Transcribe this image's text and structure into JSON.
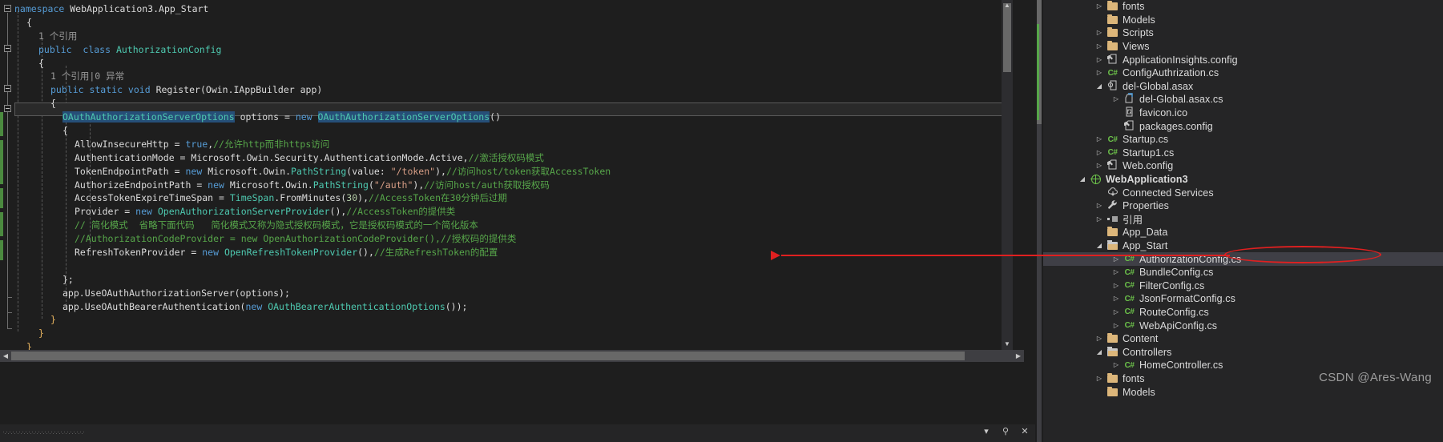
{
  "editor": {
    "selection_text": "OAuthAuthorizationServerOptions",
    "code_lines": [
      {
        "indent": 0,
        "tokens": [
          {
            "t": "namespace ",
            "c": "t-kw"
          },
          {
            "t": "WebApplication3.App_Start",
            "c": "t-txt"
          }
        ]
      },
      {
        "indent": 1,
        "tokens": [
          {
            "t": "{",
            "c": "t-punc"
          }
        ]
      },
      {
        "indent": 2,
        "tokens": [
          {
            "t": "1 个引用",
            "c": "t-hint"
          }
        ]
      },
      {
        "indent": 2,
        "tokens": [
          {
            "t": "public  ",
            "c": "t-kw"
          },
          {
            "t": "class ",
            "c": "t-kw"
          },
          {
            "t": "AuthorizationConfig",
            "c": "t-type"
          }
        ]
      },
      {
        "indent": 2,
        "tokens": [
          {
            "t": "{",
            "c": "t-punc"
          }
        ]
      },
      {
        "indent": 3,
        "tokens": [
          {
            "t": "1 个引用|0 异常",
            "c": "t-hint"
          }
        ]
      },
      {
        "indent": 3,
        "tokens": [
          {
            "t": "public static void ",
            "c": "t-kw"
          },
          {
            "t": "Register",
            "c": "t-txt"
          },
          {
            "t": "(",
            "c": "t-punc"
          },
          {
            "t": "Owin.IAppBuilder",
            "c": "t-txt"
          },
          {
            "t": " app)",
            "c": "t-punc"
          }
        ]
      },
      {
        "indent": 3,
        "tokens": [
          {
            "t": "{",
            "c": "t-punc"
          }
        ]
      },
      {
        "indent": 4,
        "tokens": [
          {
            "t": "OAuthAuthorizationServerOptions",
            "c": "sel"
          },
          {
            "t": " options = ",
            "c": "t-txt"
          },
          {
            "t": "new ",
            "c": "t-kw"
          },
          {
            "t": "OAuthAuthorizationServerOptions",
            "c": "sel"
          },
          {
            "t": "()",
            "c": "t-punc"
          }
        ]
      },
      {
        "indent": 4,
        "tokens": [
          {
            "t": "{",
            "c": "t-punc"
          }
        ]
      },
      {
        "indent": 5,
        "tokens": [
          {
            "t": "AllowInsecureHttp = ",
            "c": "t-txt"
          },
          {
            "t": "true",
            "c": "t-kw"
          },
          {
            "t": ",",
            "c": "t-punc"
          },
          {
            "t": "//允许http而非https访问",
            "c": "t-cmt"
          }
        ]
      },
      {
        "indent": 5,
        "tokens": [
          {
            "t": "AuthenticationMode = Microsoft.Owin.Security.AuthenticationMode.Active,",
            "c": "t-txt"
          },
          {
            "t": "//激活授权码模式",
            "c": "t-cmt"
          }
        ]
      },
      {
        "indent": 5,
        "tokens": [
          {
            "t": "TokenEndpointPath = ",
            "c": "t-txt"
          },
          {
            "t": "new ",
            "c": "t-kw"
          },
          {
            "t": "Microsoft.Owin.",
            "c": "t-txt"
          },
          {
            "t": "PathString",
            "c": "t-type"
          },
          {
            "t": "(value: ",
            "c": "t-punc"
          },
          {
            "t": "\"/token\"",
            "c": "t-str"
          },
          {
            "t": "),",
            "c": "t-punc"
          },
          {
            "t": "//访问host/token获取AccessToken",
            "c": "t-cmt"
          }
        ]
      },
      {
        "indent": 5,
        "tokens": [
          {
            "t": "AuthorizeEndpointPath = ",
            "c": "t-txt"
          },
          {
            "t": "new ",
            "c": "t-kw"
          },
          {
            "t": "Microsoft.Owin.",
            "c": "t-txt"
          },
          {
            "t": "PathString",
            "c": "t-type"
          },
          {
            "t": "(",
            "c": "t-punc"
          },
          {
            "t": "\"/auth\"",
            "c": "t-str"
          },
          {
            "t": "),",
            "c": "t-punc"
          },
          {
            "t": "//访问host/auth获取授权码",
            "c": "t-cmt"
          }
        ]
      },
      {
        "indent": 5,
        "tokens": [
          {
            "t": "AccessTokenExpireTimeSpan = ",
            "c": "t-txt"
          },
          {
            "t": "TimeSpan",
            "c": "t-type"
          },
          {
            "t": ".FromMinutes(",
            "c": "t-txt"
          },
          {
            "t": "30",
            "c": "t-num"
          },
          {
            "t": "),",
            "c": "t-punc"
          },
          {
            "t": "//AccessToken在30分钟后过期",
            "c": "t-cmt"
          }
        ]
      },
      {
        "indent": 5,
        "tokens": [
          {
            "t": "Provider = ",
            "c": "t-txt"
          },
          {
            "t": "new ",
            "c": "t-kw"
          },
          {
            "t": "OpenAuthorizationServerProvider",
            "c": "t-type"
          },
          {
            "t": "(),",
            "c": "t-punc"
          },
          {
            "t": "//AccessToken的提供类",
            "c": "t-cmt"
          }
        ]
      },
      {
        "indent": 5,
        "tokens": [
          {
            "t": "// 简化模式  省略下面代码   简化模式又称为隐式授权码模式，它是授权码模式的一个简化版本",
            "c": "t-cmt"
          }
        ]
      },
      {
        "indent": 5,
        "tokens": [
          {
            "t": "//AuthorizationCodeProvider = new OpenAuthorizationCodeProvider(),",
            "c": "t-cmt"
          },
          {
            "t": "//授权码的提供类",
            "c": "t-cmt"
          }
        ]
      },
      {
        "indent": 5,
        "tokens": [
          {
            "t": "RefreshTokenProvider = ",
            "c": "t-txt"
          },
          {
            "t": "new ",
            "c": "t-kw"
          },
          {
            "t": "OpenRefreshTokenProvider",
            "c": "t-type"
          },
          {
            "t": "(),",
            "c": "t-punc"
          },
          {
            "t": "//生成RefreshToken的配置",
            "c": "t-cmt"
          }
        ]
      },
      {
        "indent": 0,
        "tokens": [
          {
            "t": "",
            "c": "t-txt"
          }
        ]
      },
      {
        "indent": 4,
        "tokens": [
          {
            "t": "};",
            "c": "t-punc"
          }
        ]
      },
      {
        "indent": 4,
        "tokens": [
          {
            "t": "app.UseOAuthAuthorizationServer(options);",
            "c": "t-txt"
          }
        ]
      },
      {
        "indent": 4,
        "tokens": [
          {
            "t": "app.UseOAuthBearerAuthentication(",
            "c": "t-txt"
          },
          {
            "t": "new ",
            "c": "t-kw"
          },
          {
            "t": "OAuthBearerAuthenticationOptions",
            "c": "t-type"
          },
          {
            "t": "());",
            "c": "t-punc"
          }
        ]
      },
      {
        "indent": 3,
        "tokens": [
          {
            "t": "}",
            "c": "brace-y"
          }
        ]
      },
      {
        "indent": 2,
        "tokens": [
          {
            "t": "}",
            "c": "brace-y"
          }
        ]
      },
      {
        "indent": 1,
        "tokens": [
          {
            "t": "}",
            "c": "brace-y"
          }
        ]
      }
    ],
    "hscroll": {
      "left_arrow": "◀",
      "right_arrow": "▶"
    },
    "vscroll": {
      "up_arrow": "▲",
      "down_arrow": "▼"
    },
    "bottom_strip": {
      "dropdown_label": "▾",
      "pin_label": "⚲",
      "close_label": "✕"
    }
  },
  "solution_explorer": {
    "tree": [
      {
        "label": "fonts",
        "icon": "folder-icon",
        "indent": 2,
        "expander": "collapsed",
        "bold": false,
        "selected": false
      },
      {
        "label": "Models",
        "icon": "folder-icon",
        "indent": 2,
        "expander": "none",
        "bold": false,
        "selected": false
      },
      {
        "label": "Scripts",
        "icon": "folder-icon",
        "indent": 2,
        "expander": "collapsed",
        "bold": false,
        "selected": false
      },
      {
        "label": "Views",
        "icon": "folder-icon",
        "indent": 2,
        "expander": "collapsed",
        "bold": false,
        "selected": false
      },
      {
        "label": "ApplicationInsights.config",
        "icon": "config-file-icon",
        "indent": 2,
        "expander": "collapsed",
        "bold": false,
        "selected": false
      },
      {
        "label": "ConfigAuthrization.cs",
        "icon": "csharp-file-icon",
        "indent": 2,
        "expander": "collapsed",
        "bold": false,
        "selected": false
      },
      {
        "label": "del-Global.asax",
        "icon": "asax-file-icon",
        "indent": 2,
        "expander": "expanded",
        "bold": false,
        "selected": false
      },
      {
        "label": "del-Global.asax.cs",
        "icon": "code-behind-icon",
        "indent": 3,
        "expander": "collapsed",
        "bold": false,
        "selected": false
      },
      {
        "label": "favicon.ico",
        "icon": "image-file-icon",
        "indent": 3,
        "expander": "none",
        "bold": false,
        "selected": false
      },
      {
        "label": "packages.config",
        "icon": "config-file-icon",
        "indent": 3,
        "expander": "none",
        "bold": false,
        "selected": false
      },
      {
        "label": "Startup.cs",
        "icon": "csharp-file-icon",
        "indent": 2,
        "expander": "collapsed",
        "bold": false,
        "selected": false
      },
      {
        "label": "Startup1.cs",
        "icon": "csharp-file-icon",
        "indent": 2,
        "expander": "collapsed",
        "bold": false,
        "selected": false
      },
      {
        "label": "Web.config",
        "icon": "config-file-icon",
        "indent": 2,
        "expander": "collapsed",
        "bold": false,
        "selected": false
      },
      {
        "label": "WebApplication3",
        "icon": "web-project-icon",
        "indent": 1,
        "expander": "expanded",
        "bold": true,
        "selected": false
      },
      {
        "label": "Connected Services",
        "icon": "connected-services-icon",
        "indent": 2,
        "expander": "none",
        "bold": false,
        "selected": false
      },
      {
        "label": "Properties",
        "icon": "wrench-icon",
        "indent": 2,
        "expander": "collapsed",
        "bold": false,
        "selected": false
      },
      {
        "label": "引用",
        "icon": "references-icon",
        "indent": 2,
        "expander": "collapsed",
        "bold": false,
        "selected": false
      },
      {
        "label": "App_Data",
        "icon": "folder-icon",
        "indent": 2,
        "expander": "none",
        "bold": false,
        "selected": false
      },
      {
        "label": "App_Start",
        "icon": "folder-open-icon",
        "indent": 2,
        "expander": "expanded",
        "bold": false,
        "selected": false
      },
      {
        "label": "AuthorizationConfig.cs",
        "icon": "csharp-file-icon",
        "indent": 3,
        "expander": "collapsed",
        "bold": false,
        "selected": true
      },
      {
        "label": "BundleConfig.cs",
        "icon": "csharp-file-icon",
        "indent": 3,
        "expander": "collapsed",
        "bold": false,
        "selected": false
      },
      {
        "label": "FilterConfig.cs",
        "icon": "csharp-file-icon",
        "indent": 3,
        "expander": "collapsed",
        "bold": false,
        "selected": false
      },
      {
        "label": "JsonFormatConfig.cs",
        "icon": "csharp-file-icon",
        "indent": 3,
        "expander": "collapsed",
        "bold": false,
        "selected": false
      },
      {
        "label": "RouteConfig.cs",
        "icon": "csharp-file-icon",
        "indent": 3,
        "expander": "collapsed",
        "bold": false,
        "selected": false
      },
      {
        "label": "WebApiConfig.cs",
        "icon": "csharp-file-icon",
        "indent": 3,
        "expander": "collapsed",
        "bold": false,
        "selected": false
      },
      {
        "label": "Content",
        "icon": "folder-icon",
        "indent": 2,
        "expander": "collapsed",
        "bold": false,
        "selected": false
      },
      {
        "label": "Controllers",
        "icon": "folder-open-icon",
        "indent": 2,
        "expander": "expanded",
        "bold": false,
        "selected": false
      },
      {
        "label": "HomeController.cs",
        "icon": "csharp-file-icon",
        "indent": 3,
        "expander": "collapsed",
        "bold": false,
        "selected": false
      },
      {
        "label": "fonts",
        "icon": "folder-icon",
        "indent": 2,
        "expander": "collapsed",
        "bold": false,
        "selected": false
      },
      {
        "label": "Models",
        "icon": "folder-icon",
        "indent": 2,
        "expander": "none",
        "bold": false,
        "selected": false
      }
    ]
  },
  "watermark": {
    "text": "CSDN @Ares-Wang"
  },
  "colors": {
    "background": "#1e1e1e",
    "panel": "#252526",
    "selection": "#264f78",
    "keyword": "#569cd6",
    "type": "#4ec9b0",
    "comment": "#57a64a",
    "string": "#d69d85",
    "annotation": "#e02020",
    "folder": "#dcb67a",
    "csharp": "#6cc24a"
  }
}
